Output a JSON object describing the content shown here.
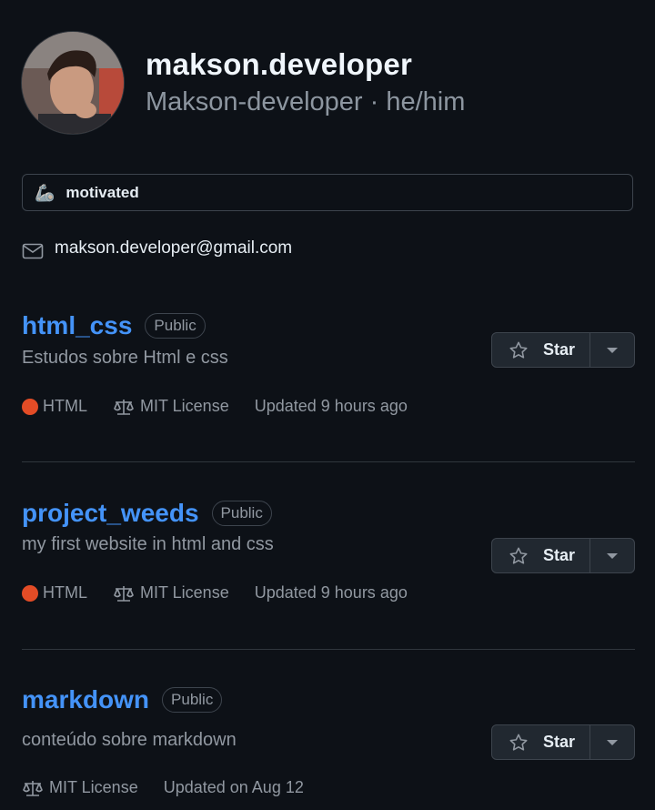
{
  "profile": {
    "display_name": "makson.developer",
    "handle_line": "Makson-developer · he/him",
    "status_emoji": "🦾",
    "status_text": "motivated",
    "email": "makson.developer@gmail.com"
  },
  "repos": [
    {
      "name": "html_css",
      "visibility": "Public",
      "description": "Estudos sobre Html e css",
      "language": "HTML",
      "language_color": "#e34c26",
      "license": "MIT License",
      "updated": "Updated 9 hours ago",
      "star_label": "Star"
    },
    {
      "name": "project_weeds",
      "visibility": "Public",
      "description": "my first website in html and css",
      "language": "HTML",
      "language_color": "#e34c26",
      "license": "MIT License",
      "updated": "Updated 9 hours ago",
      "star_label": "Star"
    },
    {
      "name": "markdown",
      "visibility": "Public",
      "description": "conteúdo sobre markdown",
      "language": "",
      "license": "MIT License",
      "updated": "Updated on Aug 12",
      "star_label": "Star"
    }
  ],
  "colors": {
    "background": "#0d1117",
    "link": "#4493f8",
    "muted": "#9198a1",
    "border": "#3d444d"
  }
}
